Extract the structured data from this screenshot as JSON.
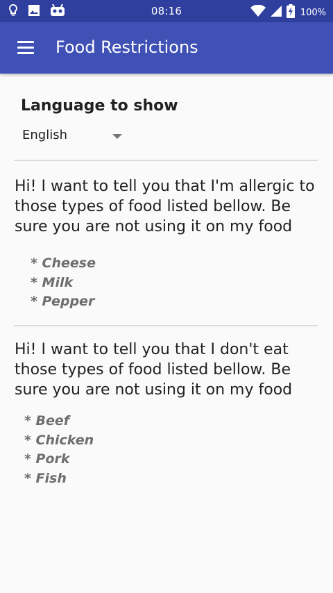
{
  "status_bar": {
    "time": "08:16",
    "battery": "100%",
    "icons": [
      "lightbulb-icon",
      "image-icon",
      "android-icon",
      "wifi-icon",
      "signal-icon",
      "battery-charging-icon"
    ]
  },
  "app_bar": {
    "title": "Food Restrictions",
    "menu_icon": "hamburger-menu-icon"
  },
  "language": {
    "heading": "Language to show",
    "selected": "English"
  },
  "sections": [
    {
      "message": "Hi! I want to tell you that I'm allergic to those types of food listed bellow. Be sure you are not using it on my food",
      "items": [
        "* Cheese",
        "* Milk",
        "* Pepper"
      ]
    },
    {
      "message": "Hi! I want to tell you that I don't eat those types of food listed bellow. Be sure you are not using it on my food",
      "items": [
        "* Beef",
        "* Chicken",
        "* Pork",
        "* Fish"
      ]
    }
  ],
  "colors": {
    "status_bar": "#2f3f9e",
    "app_bar": "#3f51b5",
    "background": "#fafafa",
    "list_text": "#6e6e6e"
  }
}
